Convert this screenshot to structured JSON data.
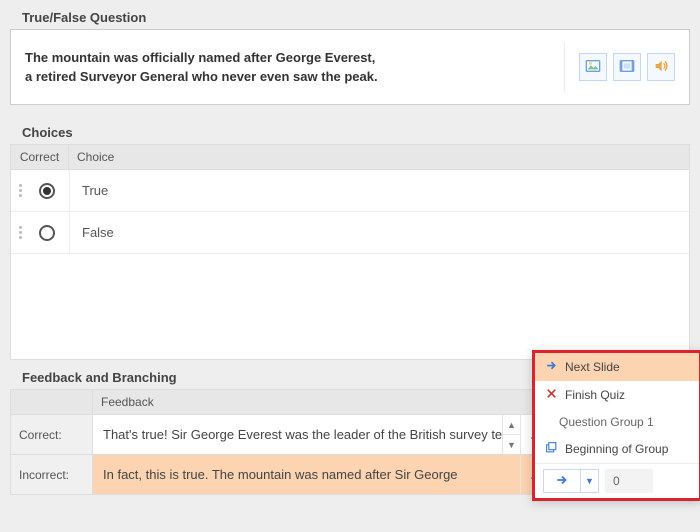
{
  "question_section": {
    "title": "True/False Question",
    "text_line1": "The mountain was officially named after George Everest,",
    "text_line2": "a retired Surveyor General who never even saw the peak."
  },
  "choices_section": {
    "title": "Choices",
    "col_correct": "Correct",
    "col_choice": "Choice",
    "rows": [
      {
        "label": "True",
        "selected": true
      },
      {
        "label": "False",
        "selected": false
      }
    ]
  },
  "feedback_section": {
    "title": "Feedback and Branching",
    "col_feedback": "Feedback",
    "rows": {
      "correct_label": "Correct:",
      "correct_text": "That's true! Sir George Everest was the leader of the British survey team which officially established the existence and the",
      "incorrect_label": "Incorrect:",
      "incorrect_text": "In fact, this is true. The mountain was named after Sir George"
    },
    "more": "..."
  },
  "branch_menu": {
    "next_slide": "Next Slide",
    "finish_quiz": "Finish Quiz",
    "group1": "Question Group 1",
    "beginning": "Beginning of Group",
    "points": "0"
  }
}
